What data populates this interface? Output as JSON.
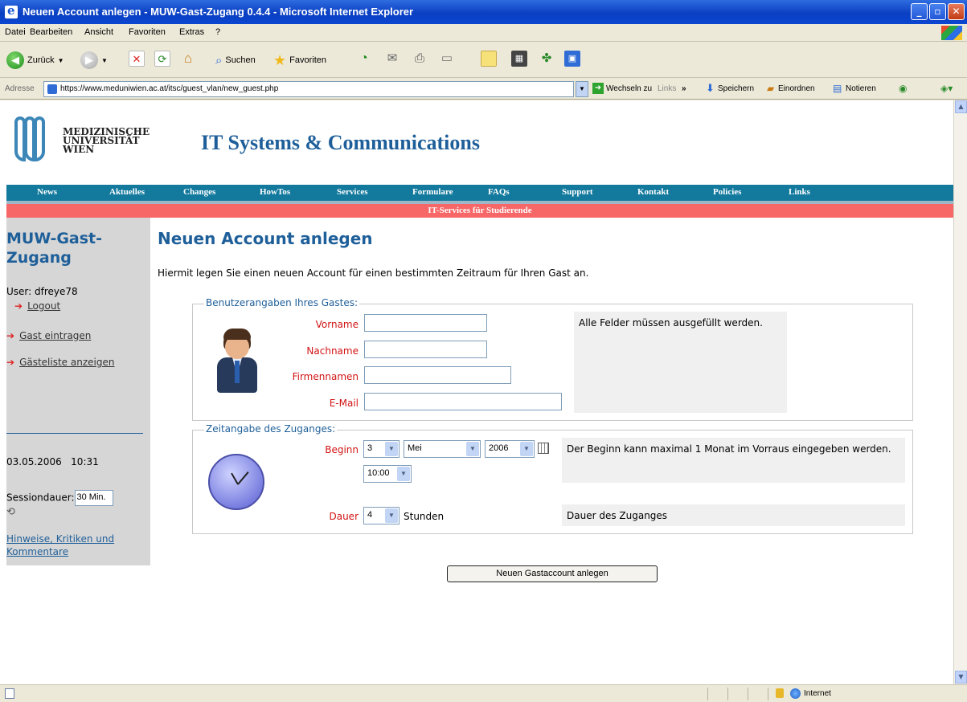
{
  "window": {
    "title": "Neuen Account anlegen - MUW-Gast-Zugang 0.4.4 - Microsoft Internet Explorer"
  },
  "menu": [
    "Datei",
    "Bearbeiten",
    "Ansicht",
    "Favoriten",
    "Extras",
    "?"
  ],
  "toolbar": {
    "back_label": "Zurück",
    "search_label": "Suchen",
    "favorites_label": "Favoriten"
  },
  "address": {
    "label": "Adresse",
    "url": "https://www.meduniwien.ac.at/itsc/guest_vlan/new_guest.php",
    "go_label": "Wechseln zu",
    "links_label": "Links",
    "save_label": "Speichern",
    "organize_label": "Einordnen",
    "notes_label": "Notieren"
  },
  "header": {
    "logo_line1": "MEDIZINISCHE",
    "logo_line2": "UNIVERSITÄT",
    "logo_line3": "WIEN",
    "site_title": "IT Systems & Communications"
  },
  "nav": [
    "News",
    "Aktuelles",
    "Changes",
    "HowTos",
    "Services",
    "Formulare",
    "FAQs",
    "Support",
    "Kontakt",
    "Policies",
    "Links"
  ],
  "subnav": "IT-Services für Studierende",
  "sidebar": {
    "app_title": "MUW-Gast-Zugang",
    "user": "User: dfreye78",
    "logout": "Logout",
    "links": [
      "Gast eintragen",
      "Gästeliste anzeigen"
    ],
    "date": "03.05.2006",
    "time": "10:31",
    "session_label": "Sessiondauer:",
    "session_value": "30 Min.",
    "feedback": "Hinweise, Kritiken und Kommentare"
  },
  "main": {
    "title": "Neuen Account anlegen",
    "intro": "Hiermit legen Sie einen neuen Account für einen bestimmten Zeitraum für Ihren Gast an.",
    "user_group": {
      "legend": "Benutzerangaben Ihres Gastes:",
      "first_name_label": "Vorname",
      "last_name_label": "Nachname",
      "company_label": "Firmennamen",
      "email_label": "E-Mail",
      "info": "Alle Felder müssen ausgefüllt werden."
    },
    "time_group": {
      "legend": "Zeitangabe des Zuganges:",
      "begin_label": "Beginn",
      "day": "3",
      "month": "Mei",
      "year": "2006",
      "time": "10:00",
      "begin_info": "Der Beginn kann maximal 1 Monat im Vorraus eingegeben werden.",
      "duration_label": "Dauer",
      "duration_value": "4",
      "duration_unit": "Stunden",
      "duration_info": "Dauer des Zuganges"
    },
    "submit_label": "Neuen Gastaccount anlegen"
  },
  "status": {
    "zone": "Internet"
  },
  "colors": {
    "accent": "#1e5f9a",
    "nav_bg": "#137a9e",
    "subnav_bg": "#f76767",
    "label_red": "#d21414"
  }
}
